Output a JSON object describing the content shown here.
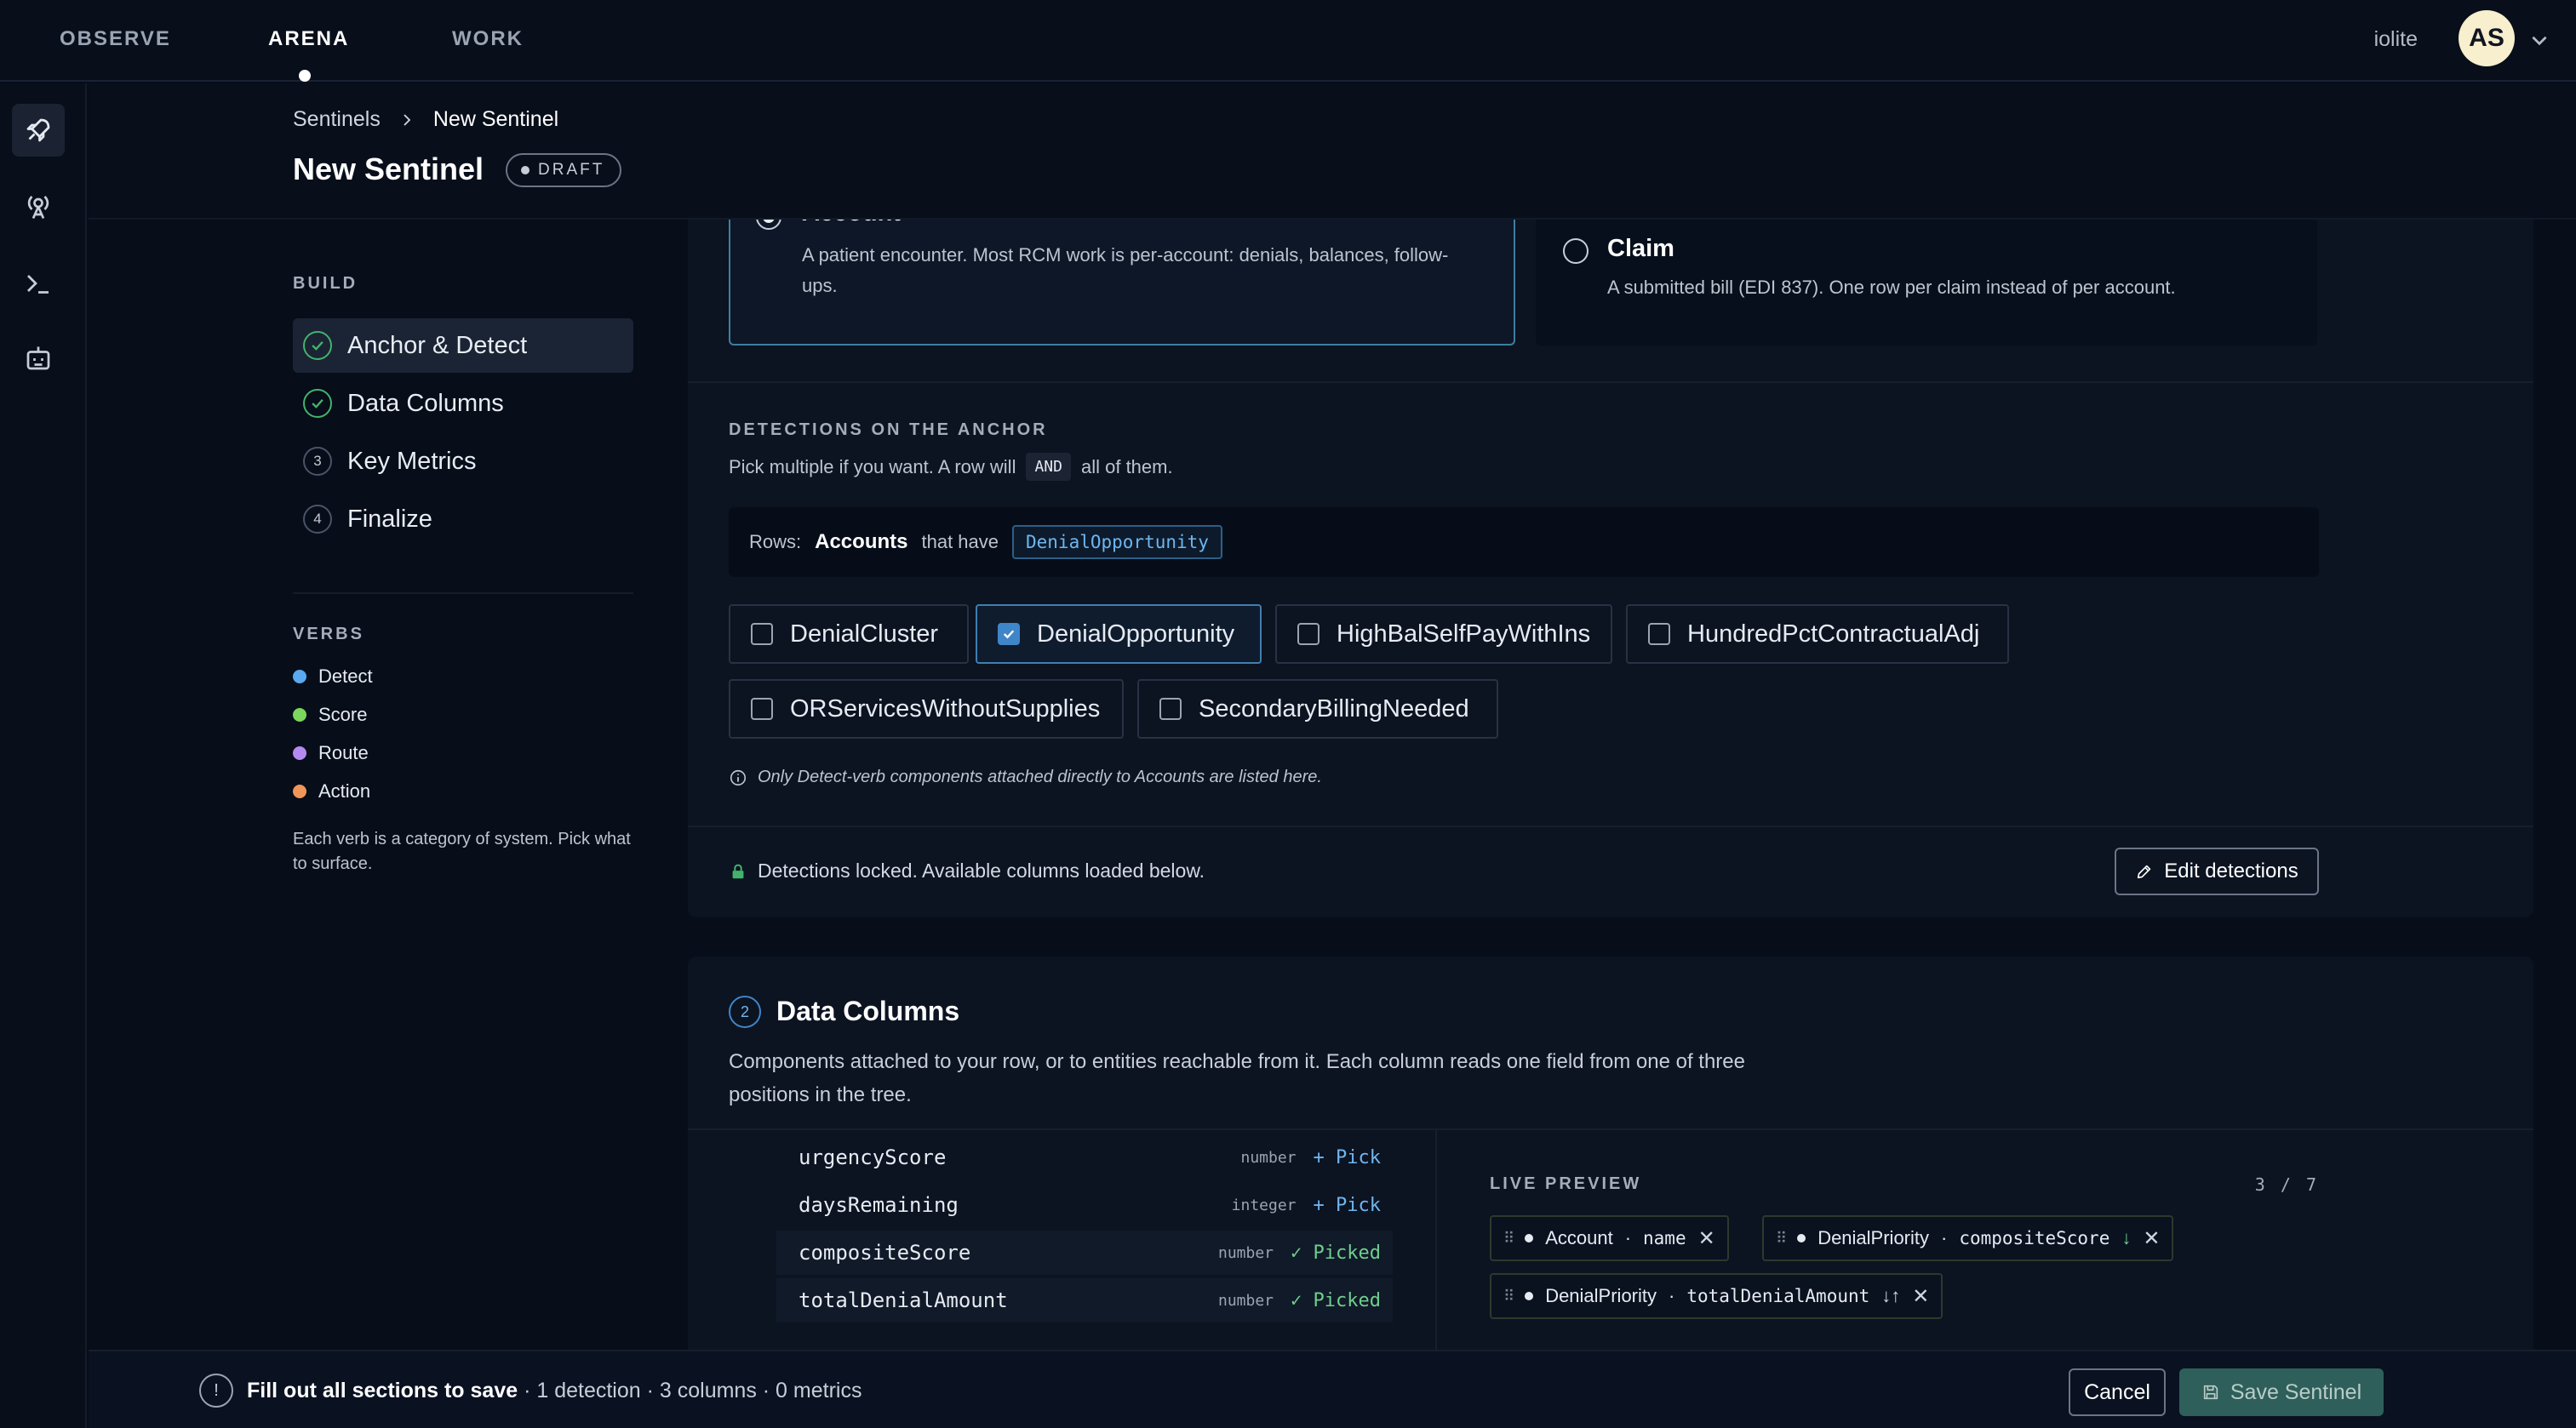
{
  "nav": {
    "items": [
      "OBSERVE",
      "ARENA",
      "WORK"
    ],
    "active": "ARENA",
    "workspace": "iolite",
    "avatar_initials": "AS"
  },
  "rail": {
    "icons": [
      "rocket-icon",
      "antenna-icon",
      "terminal-icon",
      "robot-icon"
    ]
  },
  "header": {
    "breadcrumb": [
      "Sentinels",
      "New Sentinel"
    ],
    "title": "New Sentinel",
    "badge": "DRAFT"
  },
  "build": {
    "label": "BUILD",
    "steps": [
      {
        "label": "Anchor & Detect",
        "state": "done",
        "number": "1"
      },
      {
        "label": "Data Columns",
        "state": "done",
        "number": "2"
      },
      {
        "label": "Key Metrics",
        "state": "todo",
        "number": "3"
      },
      {
        "label": "Finalize",
        "state": "todo",
        "number": "4"
      }
    ]
  },
  "verbs": {
    "label": "VERBS",
    "items": [
      {
        "label": "Detect",
        "color": "#5aa9f0"
      },
      {
        "label": "Score",
        "color": "#7bd65c"
      },
      {
        "label": "Route",
        "color": "#b48af0"
      },
      {
        "label": "Action",
        "color": "#f0955a"
      }
    ],
    "note": "Each verb is a category of system. Pick what to surface."
  },
  "anchor": {
    "account": {
      "title": "Account",
      "desc": "A patient encounter. Most RCM work is per-account: denials, balances, follow-ups.",
      "selected": true
    },
    "claim": {
      "title": "Claim",
      "desc": "A submitted bill (EDI 837). One row per claim instead of per account.",
      "selected": false
    }
  },
  "detections": {
    "heading": "DETECTIONS ON THE ANCHOR",
    "sub_before": "Pick multiple if you want. A row will",
    "and": "AND",
    "sub_after": "all of them.",
    "rows_label": "Rows:",
    "rows_entity": "Accounts",
    "rows_that_have": "that have",
    "rows_tag": "DenialOpportunity",
    "options": [
      {
        "label": "DenialCluster",
        "checked": false
      },
      {
        "label": "DenialOpportunity",
        "checked": true
      },
      {
        "label": "HighBalSelfPayWithIns",
        "checked": false
      },
      {
        "label": "HundredPctContractualAdj",
        "checked": false
      },
      {
        "label": "ORServicesWithoutSupplies",
        "checked": false
      },
      {
        "label": "SecondaryBillingNeeded",
        "checked": false
      }
    ],
    "note": "Only Detect-verb components attached directly to Accounts are listed here.",
    "locked": "Detections locked. Available columns loaded below.",
    "edit_button": "Edit detections"
  },
  "data_columns": {
    "number": "2",
    "title": "Data Columns",
    "desc": "Components attached to your row, or to entities reachable from it. Each column reads one field from one of three positions in the tree.",
    "fields": [
      {
        "name": "urgencyScore",
        "type": "number",
        "action": "+ Pick",
        "picked": false
      },
      {
        "name": "daysRemaining",
        "type": "integer",
        "action": "+ Pick",
        "picked": false
      },
      {
        "name": "compositeScore",
        "type": "number",
        "action": "✓ Picked",
        "picked": true
      },
      {
        "name": "totalDenialAmount",
        "type": "number",
        "action": "✓ Picked",
        "picked": true
      }
    ],
    "preview": {
      "heading": "LIVE PREVIEW",
      "count": "3 / 7",
      "columns": [
        {
          "entity": "Account",
          "field": "name",
          "sort": ""
        },
        {
          "entity": "DenialPriority",
          "field": "compositeScore",
          "sort": "↓"
        },
        {
          "entity": "DenialPriority",
          "field": "totalDenialAmount",
          "sort": "↓↑"
        }
      ]
    }
  },
  "footer": {
    "warning": "Fill out all sections to save",
    "summary": " · 1 detection · 3 columns · 0 metrics",
    "cancel": "Cancel",
    "save": "Save Sentinel"
  }
}
